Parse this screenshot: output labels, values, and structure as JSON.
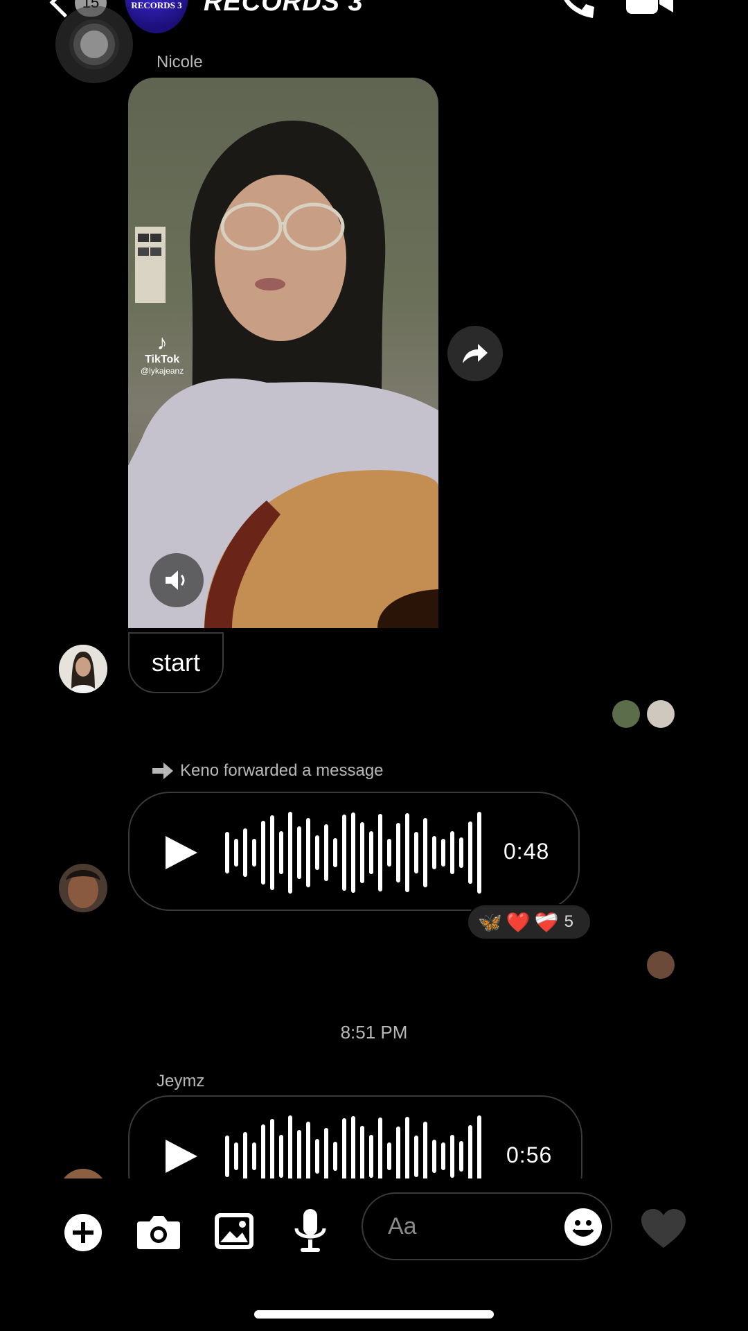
{
  "header": {
    "back_badge": "15",
    "group_avatar_text": "RECORDS 3",
    "title": "RECORDS 3",
    "call_icon": "phone-icon",
    "video_icon": "video-camera-icon"
  },
  "messages": {
    "nicole": {
      "sender": "Nicole",
      "tiktok_logo": "TikTok",
      "tiktok_handle": "@lykajeanz",
      "text": "start"
    },
    "forward_note": "Keno forwarded a message",
    "audio1": {
      "duration": "0:48",
      "reaction_count": "5",
      "reactions": [
        "🦋",
        "❤️",
        "❤️‍🩹"
      ]
    },
    "timestamp": "8:51 PM",
    "jeymz": {
      "sender": "Jeymz",
      "duration": "0:56"
    }
  },
  "composer": {
    "placeholder": "Aa",
    "icons": [
      "plus-icon",
      "camera-icon",
      "gallery-icon",
      "microphone-icon",
      "emoji-icon",
      "heart-icon"
    ]
  },
  "colors": {
    "background": "#000000",
    "bubble_border": "#3a3a3a",
    "reaction_bg": "#262626"
  }
}
